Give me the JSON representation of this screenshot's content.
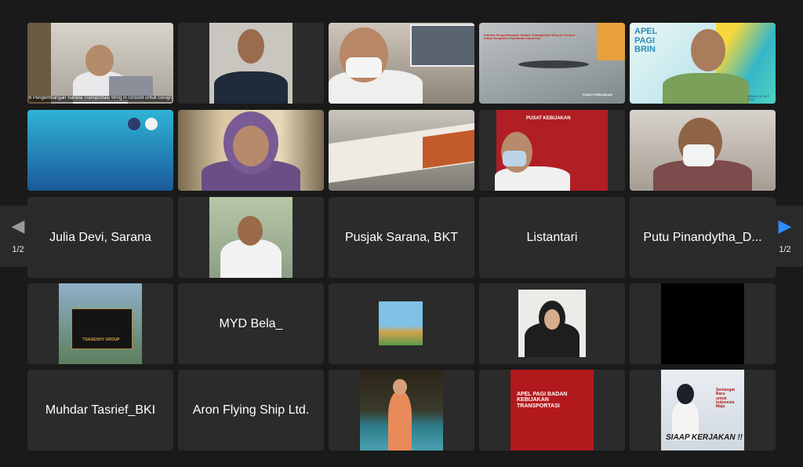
{
  "tiles": {
    "t1": {
      "caption": "6 Pengembangan Sarana Transportasi Wing in Ground untuk Geografis Kepulauan"
    },
    "t4": {
      "slide_title": "Potensi Pengembangan Sarana Transportasi Wing in Ground untuk Geografis Kepulauan Indonesia",
      "slide_footer": "PUSAT KEBIJAKAN"
    },
    "t5": {
      "slide_title": "APEL PAGI BRIN",
      "slide_date": "SENIN, 31 OKT 2022"
    },
    "t9": {
      "slide_title": "PUSAT KEBIJAKAN"
    },
    "r3": [
      "Julia Devi, Sarana",
      "",
      "Pusjak Sarana, BKT",
      "Listantari",
      "Putu Pinandytha_D..."
    ],
    "r4": [
      "",
      "MYD Bela_",
      "",
      "",
      ""
    ],
    "r4_logo": "TSAGESHY GROUP",
    "r5": [
      "Muhdar Tasrief_BKI",
      "Aron Flying Ship Ltd.",
      "",
      "",
      ""
    ],
    "r5_slide": {
      "title": "APEL PAGI BADAN KEBIJAKAN TRANSPORTASI"
    },
    "r5_poster": {
      "line1": "Semangat",
      "line2": "Baru",
      "line3": "untuk",
      "line4": "Indonesia",
      "line5": "Maju",
      "tagline": "SIAAP KERJAKAN !!"
    }
  },
  "pager": {
    "left_label": "1/2",
    "right_label": "1/2"
  },
  "colors": {
    "active_border": "#35c93b",
    "tile_bg": "#2b2b2b",
    "arrow_right": "#2d8cff"
  }
}
